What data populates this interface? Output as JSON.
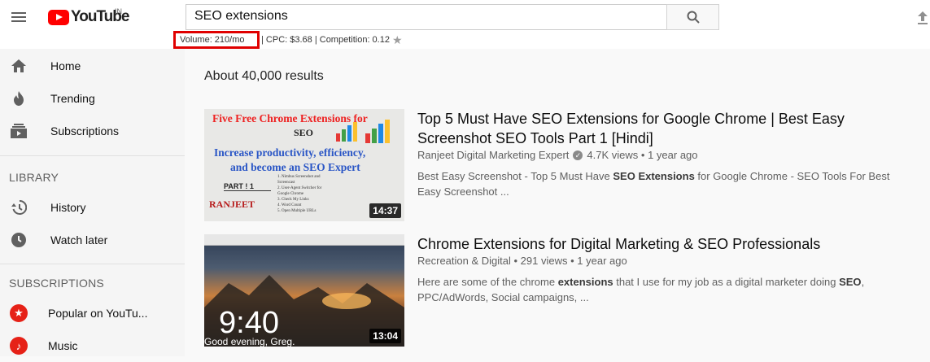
{
  "header": {
    "logo_text": "YouTube",
    "logo_country": "IN",
    "search_value": "SEO extensions"
  },
  "seo_bar": {
    "volume": "Volume: 210/mo",
    "rest": "| CPC: $3.68 | Competition: 0.12"
  },
  "sidebar": {
    "items": [
      {
        "label": "Home",
        "icon": "home-icon"
      },
      {
        "label": "Trending",
        "icon": "flame-icon"
      },
      {
        "label": "Subscriptions",
        "icon": "subscriptions-icon"
      }
    ],
    "library_heading": "LIBRARY",
    "library_items": [
      {
        "label": "History",
        "icon": "history-icon"
      },
      {
        "label": "Watch later",
        "icon": "clock-icon"
      }
    ],
    "subscriptions_heading": "SUBSCRIPTIONS",
    "subscriptions_items": [
      {
        "label": "Popular on YouTu...",
        "icon": "star-icon"
      },
      {
        "label": "Music",
        "icon": "music-icon"
      }
    ]
  },
  "main": {
    "results_count": "About 40,000 results",
    "videos": [
      {
        "title": "Top 5 Must Have SEO Extensions for Google Chrome | Best Easy Screenshot SEO Tools Part 1 [Hindi]",
        "channel": "Ranjeet Digital Marketing Expert",
        "views": "4.7K views",
        "age": "1 year ago",
        "desc_pre": "Best Easy Screenshot - Top 5 Must Have ",
        "desc_bold": "SEO Extensions",
        "desc_post": " for Google Chrome - SEO Tools For Best Easy Screenshot ...",
        "duration": "14:37",
        "thumb": {
          "title": "Five Free Chrome Extensions for",
          "seo": "SEO",
          "line1": "Increase productivity, efficiency,",
          "line2": "and become an SEO Expert",
          "part": "PART ! 1",
          "list": [
            "1. Nimbus Screenshot and",
            "Screencast",
            "2. User-Agent Switcher for",
            "Google Chrome",
            "3. Check My Links",
            "4. Word Count",
            "5. Open Multiple URLs"
          ],
          "brand": "RANJEET"
        }
      },
      {
        "title": "Chrome Extensions for Digital Marketing & SEO Professionals",
        "channel": "Recreation & Digital",
        "views": "291 views",
        "age": "1 year ago",
        "desc_a": "Here are some of the chrome ",
        "desc_b": "extensions",
        "desc_c": " that I use for my job as a digital marketer doing ",
        "desc_d": "SEO",
        "desc_e": ",",
        "desc_f": "PPC/AdWords, Social campaigns, ...",
        "duration": "13:04",
        "thumb": {
          "time": "9:40",
          "greeting": "Good evening, Greg."
        }
      }
    ]
  }
}
